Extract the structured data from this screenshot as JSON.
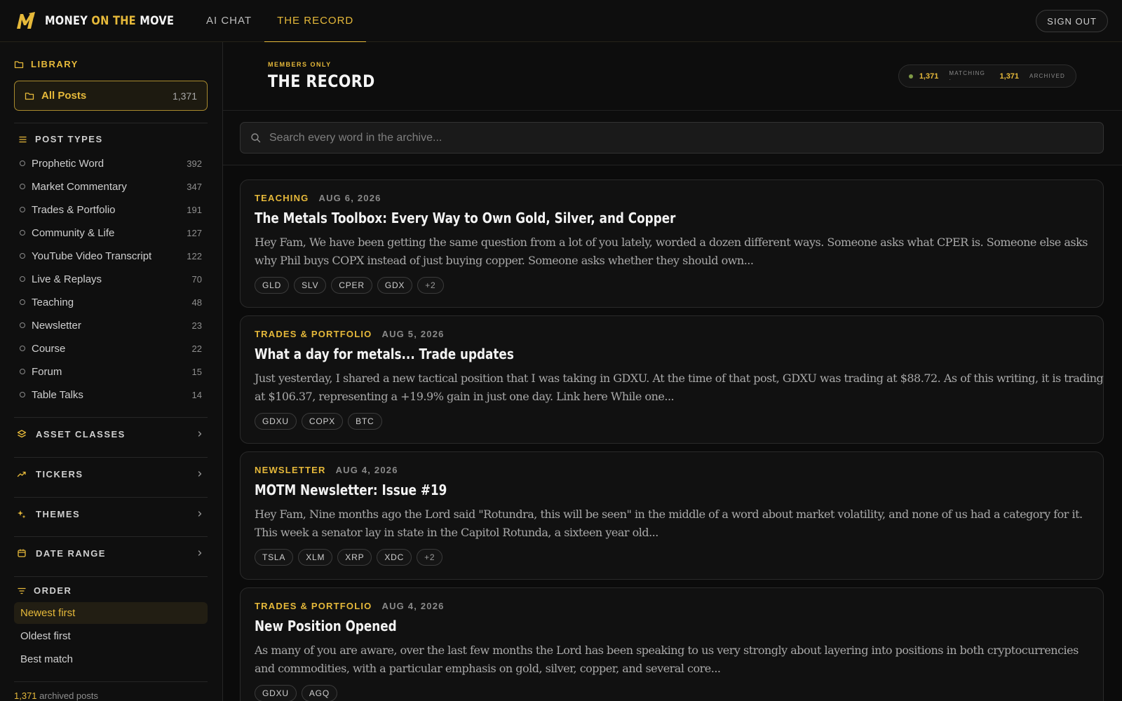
{
  "brand": {
    "part1": "MONEY ",
    "part2": "ON THE",
    "part3": " MOVE"
  },
  "nav": {
    "tabs": [
      {
        "label": "AI CHAT"
      },
      {
        "label": "THE RECORD"
      }
    ],
    "signout": "SIGN OUT"
  },
  "sidebar": {
    "library_label": "LIBRARY",
    "all_posts": {
      "label": "All Posts",
      "count": "1,371"
    },
    "post_types_label": "POST TYPES",
    "post_types": [
      {
        "label": "Prophetic Word",
        "count": "392"
      },
      {
        "label": "Market Commentary",
        "count": "347"
      },
      {
        "label": "Trades & Portfolio",
        "count": "191"
      },
      {
        "label": "Community & Life",
        "count": "127"
      },
      {
        "label": "YouTube Video Transcript",
        "count": "122"
      },
      {
        "label": "Live & Replays",
        "count": "70"
      },
      {
        "label": "Teaching",
        "count": "48"
      },
      {
        "label": "Newsletter",
        "count": "23"
      },
      {
        "label": "Course",
        "count": "22"
      },
      {
        "label": "Forum",
        "count": "15"
      },
      {
        "label": "Table Talks",
        "count": "14"
      }
    ],
    "sections": [
      {
        "label": "ASSET CLASSES"
      },
      {
        "label": "TICKERS"
      },
      {
        "label": "THEMES"
      },
      {
        "label": "DATE RANGE"
      }
    ],
    "order_label": "ORDER",
    "order_options": [
      {
        "label": "Newest first"
      },
      {
        "label": "Oldest first"
      },
      {
        "label": "Best match"
      }
    ],
    "footer": {
      "count": "1,371",
      "text": " archived posts"
    }
  },
  "header": {
    "eyebrow": "MEMBERS ONLY",
    "title": "THE RECORD",
    "stats": {
      "matching_count": "1,371",
      "matching_label": "MATCHING ·",
      "archived_count": "1,371",
      "archived_label": "ARCHIVED"
    }
  },
  "search": {
    "placeholder": "Search every word in the archive..."
  },
  "posts": [
    {
      "category": "TEACHING",
      "date": "AUG 6, 2026",
      "title": "The Metals Toolbox: Every Way to Own Gold, Silver, and Copper",
      "excerpt_line1": "Hey Fam, We have been getting the same question from a lot of you lately, worded a dozen different ways. Someone asks what CPER is. Someone else asks",
      "excerpt_line2": "why Phil buys COPX instead of just buying copper. Someone asks whether they should own...",
      "tags": [
        "GLD",
        "SLV",
        "CPER",
        "GDX",
        "+2"
      ]
    },
    {
      "category": "TRADES & PORTFOLIO",
      "date": "AUG 5, 2026",
      "title": "What a day for metals... Trade updates",
      "excerpt_line1": "Just yesterday, I shared a new tactical position that I was taking in GDXU. At the time of that post, GDXU was trading at $88.72. As of this writing, it is trading",
      "excerpt_line2": "at $106.37, representing a +19.9% gain in just one day. Link here While one...",
      "tags": [
        "GDXU",
        "COPX",
        "BTC"
      ]
    },
    {
      "category": "NEWSLETTER",
      "date": "AUG 4, 2026",
      "title": "MOTM Newsletter: Issue #19",
      "excerpt_line1": "Hey Fam, Nine months ago the Lord said \"Rotundra, this will be seen\" in the middle of a word about market volatility, and none of us had a category for it.",
      "excerpt_line2": "This week a senator lay in state in the Capitol Rotunda, a sixteen year old...",
      "tags": [
        "TSLA",
        "XLM",
        "XRP",
        "XDC",
        "+2"
      ]
    },
    {
      "category": "TRADES & PORTFOLIO",
      "date": "AUG 4, 2026",
      "title": "New Position Opened",
      "excerpt_line1": "As many of you are aware, over the last few months the Lord has been speaking to us very strongly about layering into positions in both cryptocurrencies",
      "excerpt_line2": "and commodities, with a particular emphasis on gold, silver, copper, and several core...",
      "tags": [
        "GDXU",
        "AGQ"
      ]
    }
  ]
}
